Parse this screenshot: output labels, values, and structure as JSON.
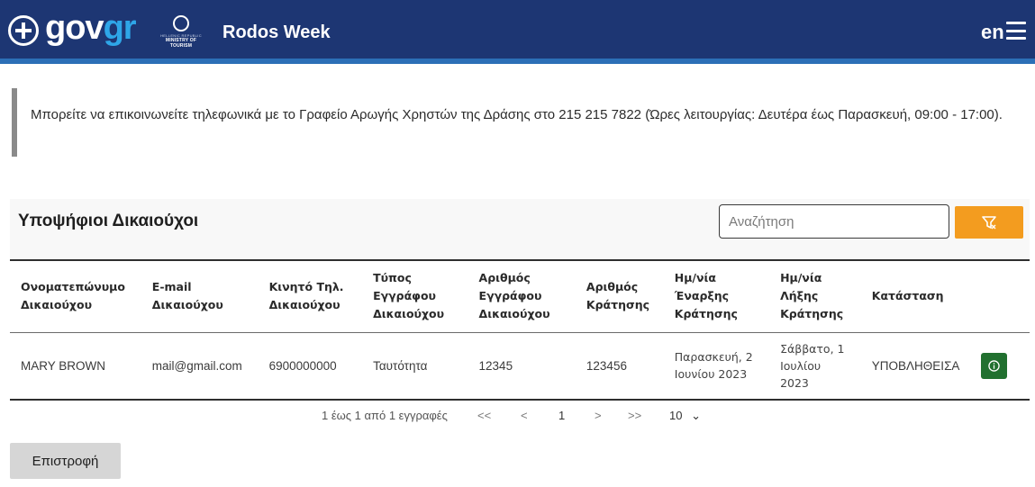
{
  "header": {
    "logo_main": "gov",
    "logo_accent": "gr",
    "ministry_line1": "HELLENIC REPUBLIC",
    "ministry_line2": "MINISTRY OF TOURISM",
    "app_title": "Rodos Week",
    "language": "en",
    "menu_icon": "hamburger-menu-icon"
  },
  "notice": {
    "text": "Μπορείτε να επικοινωνείτε τηλεφωνικά με το Γραφείο Αρωγής Χρηστών της Δράσης στο 215 215 7822 (Ώρες λειτουργίας: Δευτέρα έως Παρασκευή, 09:00 - 17:00)."
  },
  "panel": {
    "title": "Υποψήφιοι Δικαιούχοι",
    "search_placeholder": "Αναζήτηση",
    "filter_icon": "filter-icon",
    "accent_color": "#f39c1f"
  },
  "table": {
    "columns": [
      "Ονοματεπώνυμο Δικαιούχου",
      "E-mail Δικαιούχου",
      "Κινητό Τηλ. Δικαιούχου",
      "Τύπος Εγγράφου Δικαιούχου",
      "Αριθμός Εγγράφου Δικαιούχου",
      "Αριθμός Κράτησης",
      "Ημ/νία Έναρξης Κράτησης",
      "Ημ/νία Λήξης Κράτησης",
      "Κατάσταση"
    ],
    "rows": [
      {
        "name": "MARY BROWN",
        "email": "mail@gmail.com",
        "phone": "6900000000",
        "doc_type": "Ταυτότητα",
        "doc_number": "12345",
        "booking_number": "123456",
        "start_date": "Παρασκευή, 2 Ιουνίου 2023",
        "end_date": "Σάββατο, 1 Ιουλίου 2023",
        "status": "ΥΠΟΒΛΗΘΕΙΣΑ",
        "action_icon": "info-icon"
      }
    ]
  },
  "pagination": {
    "summary": "1 έως 1 από 1 εγγραφές",
    "first": "<<",
    "prev": "<",
    "current_page": "1",
    "next": ">",
    "last": ">>",
    "page_size": "10"
  },
  "footer": {
    "back_label": "Επιστροφή"
  },
  "colors": {
    "header_bg": "#1d3673",
    "header_stripe": "#2c6fb7",
    "action_green": "#21702f",
    "back_button_bg": "#d6d6d6"
  }
}
